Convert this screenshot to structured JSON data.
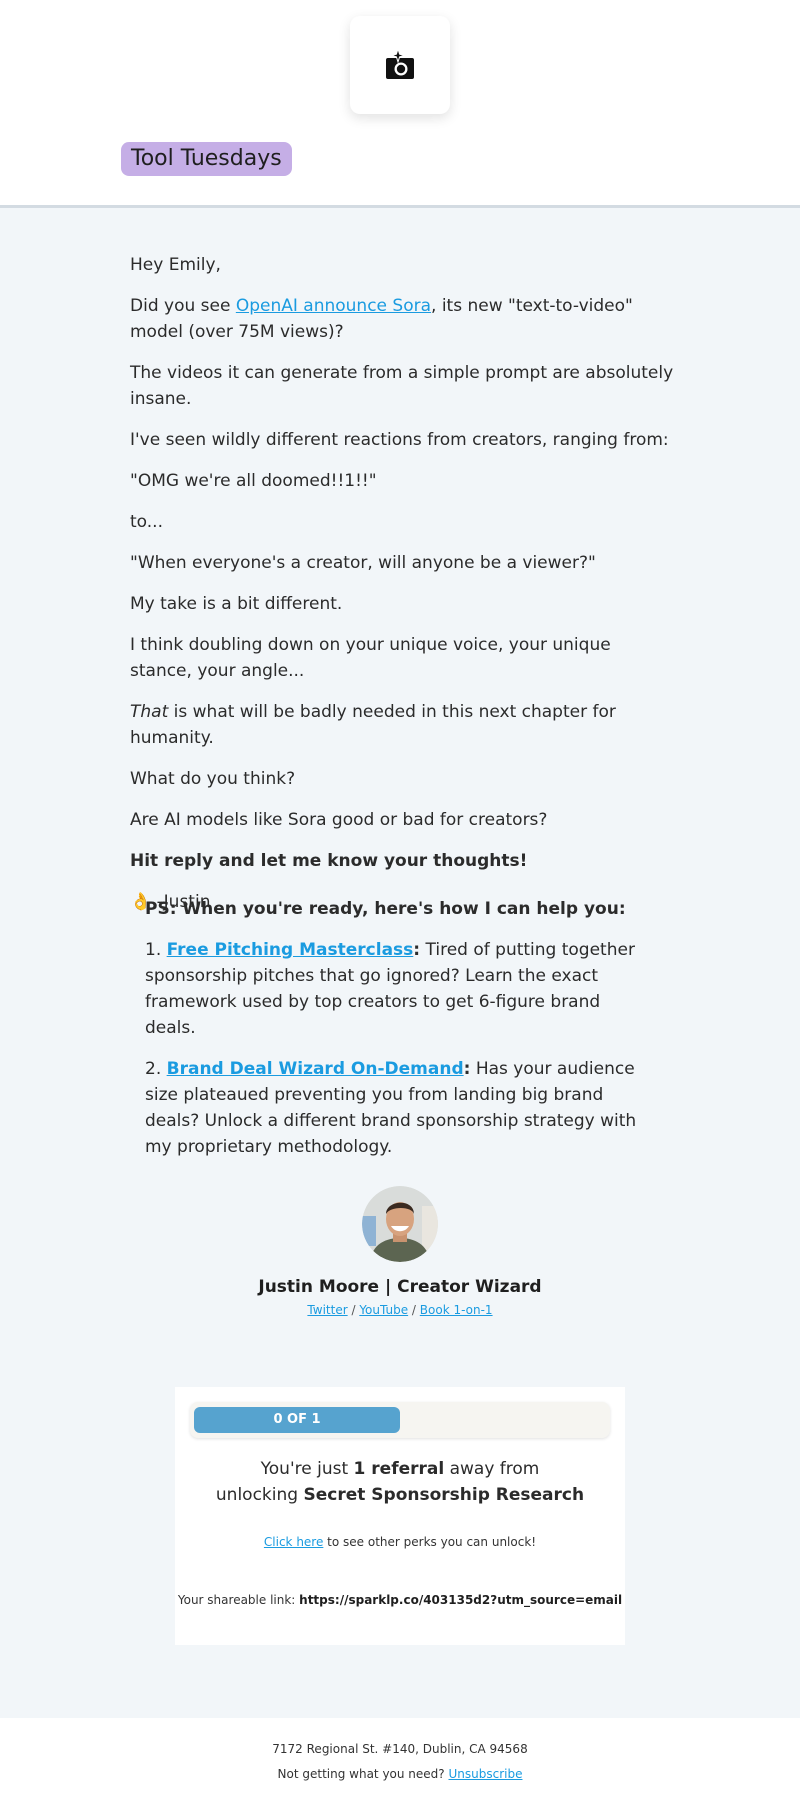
{
  "header": {
    "logo_icon": "camera-sparkle-icon",
    "tag": "Tool Tuesdays",
    "tag_color": "#c5aee6"
  },
  "body": {
    "greeting": "Hey Emily,",
    "p1_before": "Did you see ",
    "p1_link": "OpenAI announce Sora",
    "p1_after": ", its new \"text-to-video\" model (over 75M views)?",
    "p2": "The videos it can generate from a simple prompt are absolutely insane.",
    "p3": "I've seen wildly different reactions from creators, ranging from:",
    "p4": "\"OMG we're all doomed!!1!!\"",
    "p5": "to...",
    "p6": "\"When everyone's a creator, will anyone be a viewer?\"",
    "p7": "My take is a bit different.",
    "p8": "I think doubling down on your unique voice, your unique stance, your angle...",
    "p9_em": "That",
    "p9_rest": " is what will be badly needed in this next chapter for humanity.",
    "p10": "What do you think?",
    "p11": "Are AI models like Sora good or bad for creators?",
    "p12": "Hit reply and let me know your thoughts!",
    "signoff_emoji": "👌",
    "signoff": " -Justin"
  },
  "ps": {
    "heading": "PS: When you're ready, here's how I can help you:",
    "items": [
      {
        "num": "1. ",
        "link": "Free Pitching Masterclass",
        "colon": ":",
        "text": " Tired of putting together sponsorship pitches that go ignored? Learn the exact framework used by top creators to get 6-figure brand deals."
      },
      {
        "num": "2. ",
        "link": "Brand Deal Wizard On-Demand",
        "colon": ":",
        "text": " Has your audience size plateaued preventing you from landing big brand deals? Unlock a different brand sponsorship strategy with my proprietary methodology."
      }
    ]
  },
  "signature": {
    "name": "Justin Moore | Creator Wizard",
    "links": [
      "Twitter",
      "YouTube",
      "Book 1-on-1"
    ],
    "separator": " / "
  },
  "referral": {
    "progress_label": "0 OF 1",
    "progress_color": "#56a3cf",
    "line1_before": "You're just ",
    "line1_bold": "1 referral",
    "line1_after": " away from",
    "line2_before": "unlocking ",
    "line2_bold": "Secret Sponsorship Research",
    "perks_link": "Click here",
    "perks_text": " to see other perks you can unlock!",
    "share_label": "Your shareable link: ",
    "share_url": "https://sparklp.co/403135d2?utm_source=email"
  },
  "footer": {
    "address": "7172 Regional St. #140, Dublin, CA 94568",
    "unsub_text": "Not getting what you need? ",
    "unsub_link": "Unsubscribe"
  }
}
